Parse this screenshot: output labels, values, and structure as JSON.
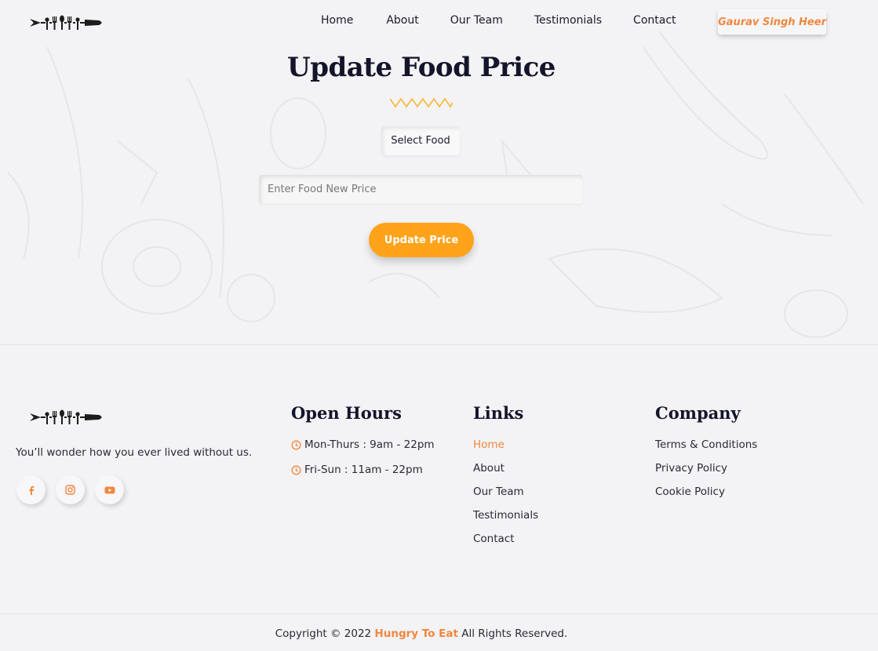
{
  "header": {
    "logo_icon": "cutlery-carrot-logo-icon",
    "nav": [
      "Home",
      "About",
      "Our Team",
      "Testimonials",
      "Contact"
    ],
    "user_name": "Gaurav Singh Heer"
  },
  "main": {
    "title": "Update Food Price",
    "select_food_label": "Select Food",
    "price_input": {
      "value": "",
      "placeholder": "Enter Food New Price"
    },
    "update_button": "Update Price"
  },
  "footer": {
    "tagline": "You’ll wonder how you ever lived without us.",
    "social_icons": [
      "facebook-icon",
      "instagram-icon",
      "youtube-icon"
    ],
    "open_hours": {
      "heading": "Open Hours",
      "items": [
        "Mon-Thurs : 9am - 22pm",
        "Fri-Sun : 11am - 22pm"
      ]
    },
    "links": {
      "heading": "Links",
      "items": [
        "Home",
        "About",
        "Our Team",
        "Testimonials",
        "Contact"
      ]
    },
    "company": {
      "heading": "Company",
      "items": [
        "Terms & Conditions",
        "Privacy Policy",
        "Cookie Policy"
      ]
    },
    "copyright": {
      "prefix": "Copyright © 2022",
      "brand": "Hungry To Eat",
      "suffix": "All Rights Reserved."
    }
  },
  "colors": {
    "accent_orange": "#f0873f",
    "button_orange": "#ffa31a",
    "heading_navy": "#14142a",
    "background": "#f3f2f4"
  }
}
